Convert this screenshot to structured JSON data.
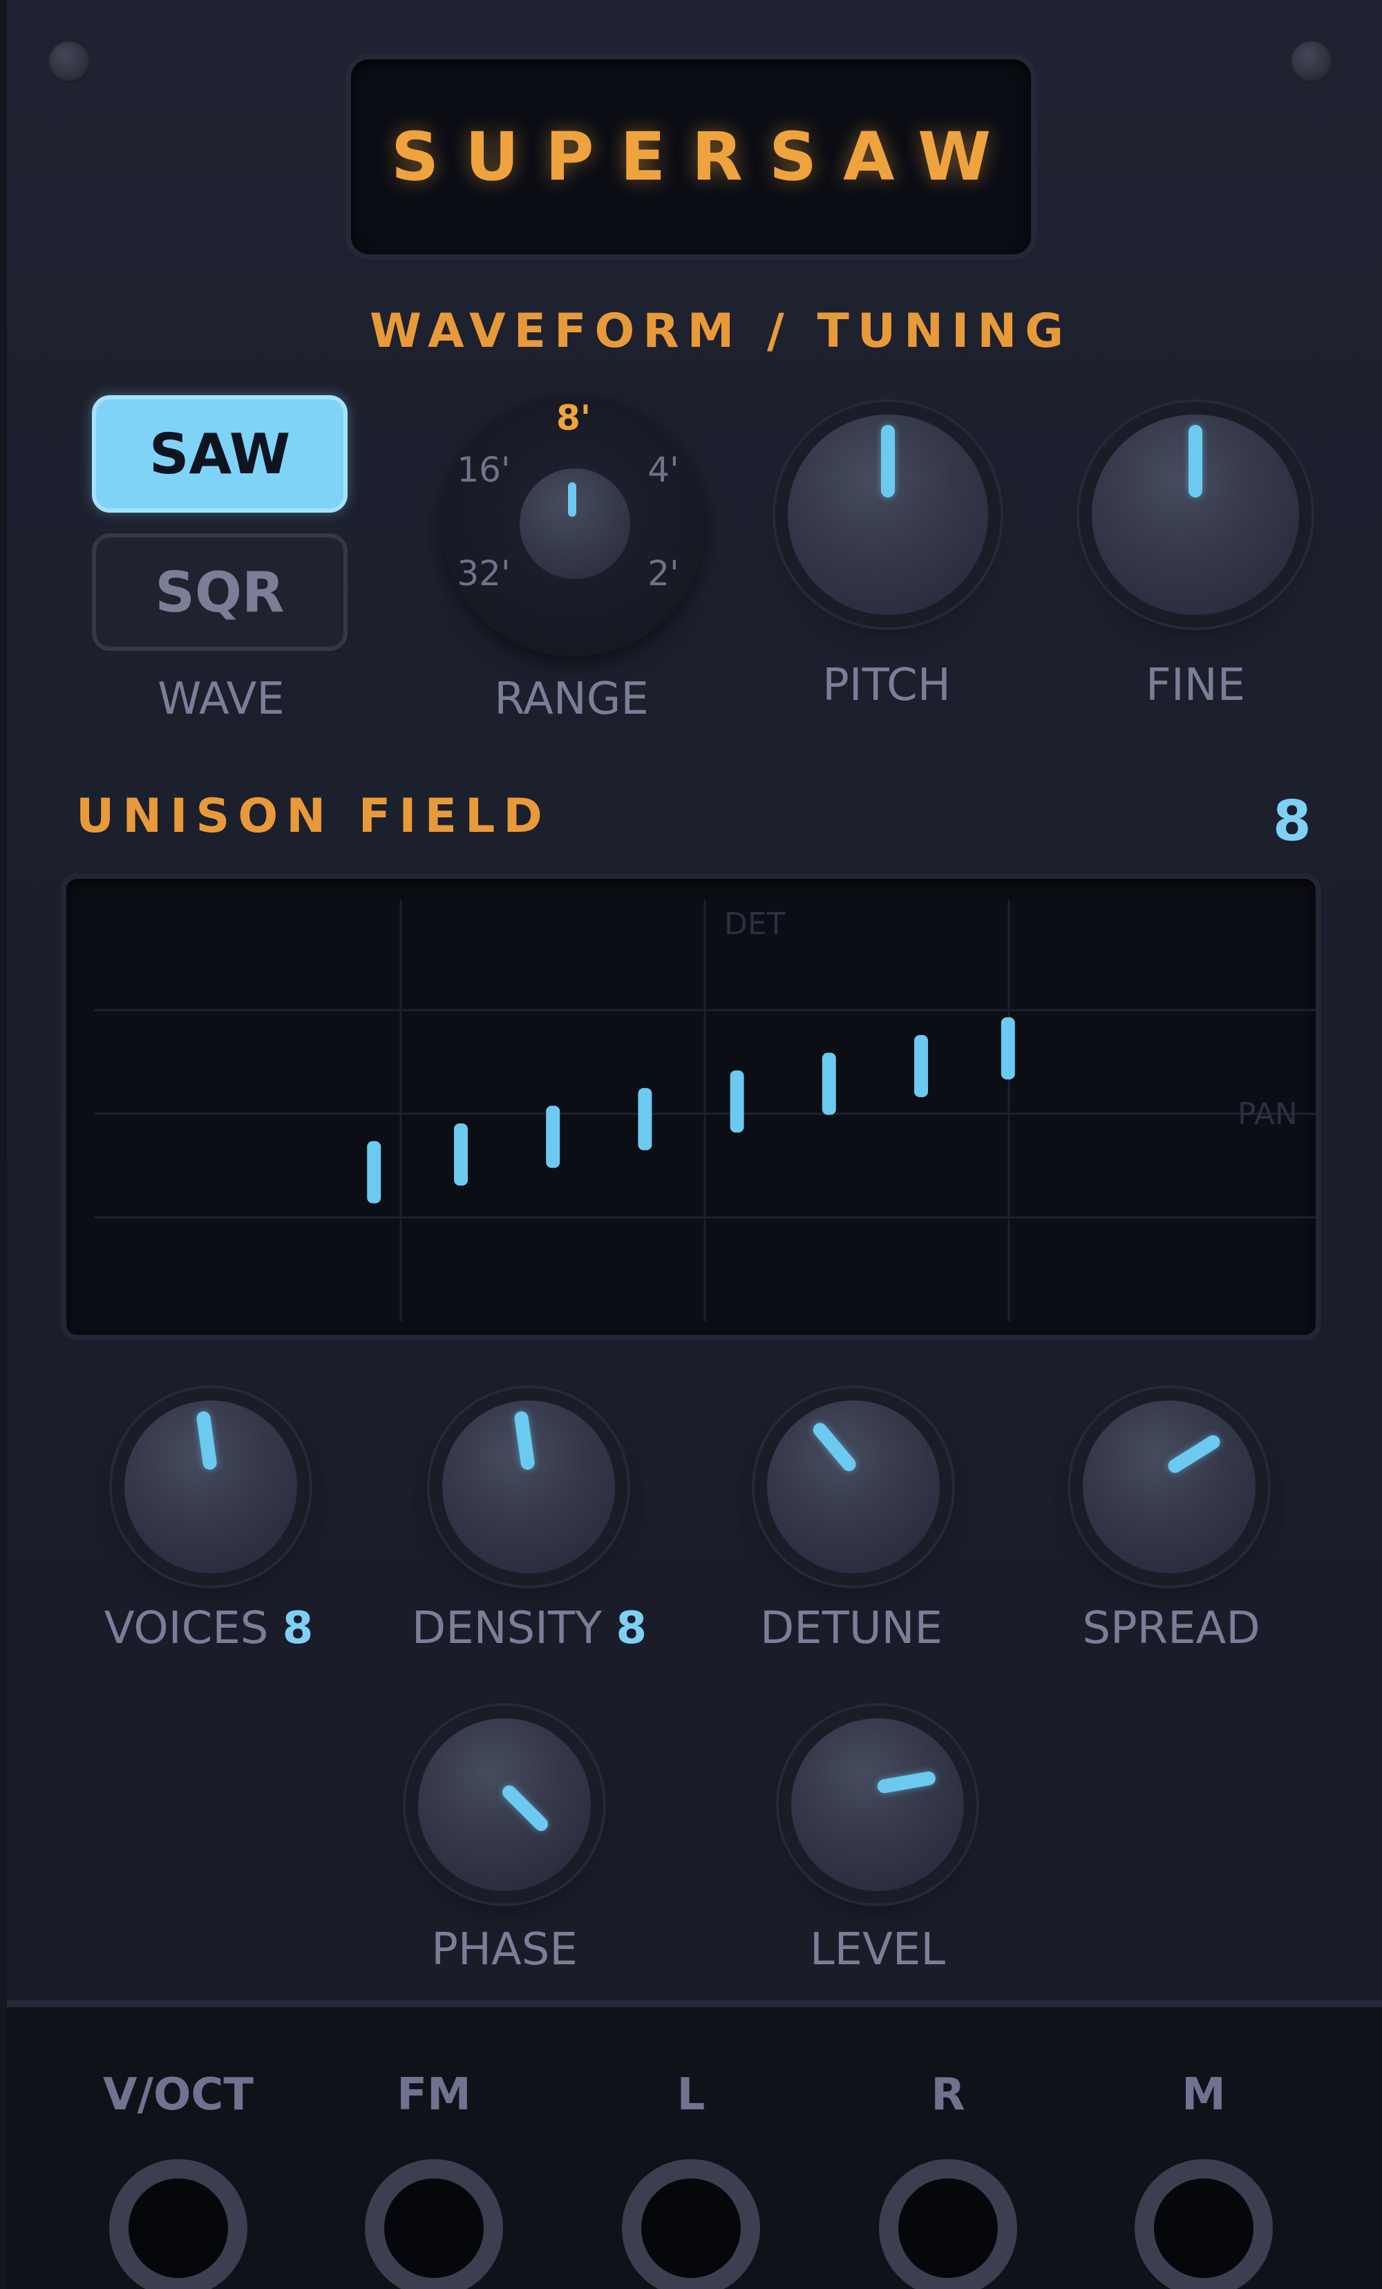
{
  "module": {
    "name": "SUPERSAW",
    "accent_color": "#efa33f",
    "highlight_color": "#7fd3f7"
  },
  "waveform_section": {
    "title": "WAVEFORM / TUNING",
    "wave": {
      "options": [
        "SAW",
        "SQR"
      ],
      "selected": "SAW",
      "label": "WAVE"
    },
    "range": {
      "label": "RANGE",
      "marks": [
        "32'",
        "16'",
        "8'",
        "4'",
        "2'"
      ],
      "selected": "8'"
    },
    "pitch": {
      "label": "PITCH",
      "value": 0.5
    },
    "fine": {
      "label": "FINE",
      "value": 0.5
    }
  },
  "unison_section": {
    "title": "UNISON FIELD",
    "voice_count": "8",
    "axis_labels": {
      "vertical": "DET",
      "horizontal": "PAN"
    },
    "voices": [
      {
        "pan": -0.62,
        "detune": -0.28
      },
      {
        "pan": -0.45,
        "detune": -0.2
      },
      {
        "pan": -0.27,
        "detune": -0.12
      },
      {
        "pan": -0.09,
        "detune": -0.04
      },
      {
        "pan": 0.09,
        "detune": 0.04
      },
      {
        "pan": 0.27,
        "detune": 0.12
      },
      {
        "pan": 0.45,
        "detune": 0.2
      },
      {
        "pan": 0.62,
        "detune": 0.28
      }
    ]
  },
  "knobs_row1": [
    {
      "id": "voices",
      "label": "VOICES",
      "value_text": "8",
      "angle": -8
    },
    {
      "id": "density",
      "label": "DENSITY",
      "value_text": "8",
      "angle": -8
    },
    {
      "id": "detune",
      "label": "DETUNE",
      "value_text": "",
      "angle": -40
    },
    {
      "id": "spread",
      "label": "SPREAD",
      "value_text": "",
      "angle": 58
    }
  ],
  "knobs_row2": [
    {
      "id": "phase",
      "label": "PHASE",
      "angle": 135
    },
    {
      "id": "level",
      "label": "LEVEL",
      "angle": 80
    }
  ],
  "jacks": [
    {
      "id": "voct",
      "label": "V/OCT"
    },
    {
      "id": "fm",
      "label": "FM"
    },
    {
      "id": "l",
      "label": "L"
    },
    {
      "id": "r",
      "label": "R"
    },
    {
      "id": "m",
      "label": "M"
    }
  ]
}
